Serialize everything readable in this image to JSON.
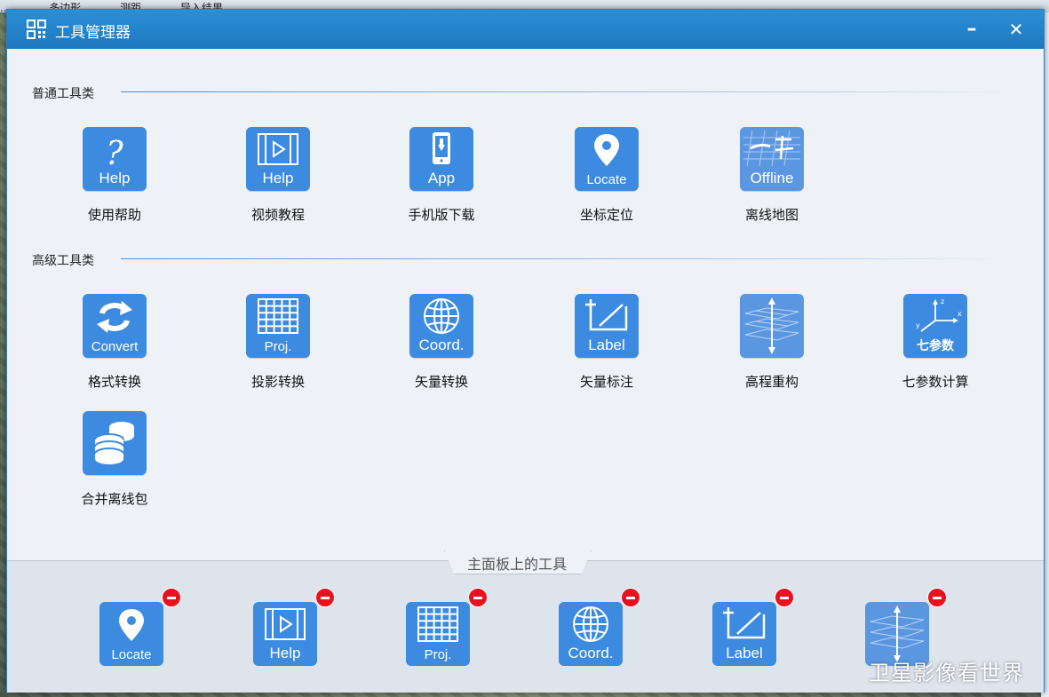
{
  "background": {
    "top_items": [
      "...",
      "多边形",
      "测距",
      "导入结果"
    ]
  },
  "window": {
    "title": "工具管理器",
    "minimize_label": "–",
    "close_label": "✕"
  },
  "sections": [
    {
      "label": "普通工具类",
      "tools": [
        {
          "label": "使用帮助",
          "icon": "help-question-icon",
          "icon_text": "Help"
        },
        {
          "label": "视频教程",
          "icon": "video-icon",
          "icon_text": "Help"
        },
        {
          "label": "手机版下载",
          "icon": "phone-download-icon",
          "icon_text": "App"
        },
        {
          "label": "坐标定位",
          "icon": "location-pin-icon",
          "icon_text": "Locate"
        },
        {
          "label": "离线地图",
          "icon": "offline-map-icon",
          "icon_text": "Offline"
        }
      ]
    },
    {
      "label": "高级工具类",
      "tools": [
        {
          "label": "格式转换",
          "icon": "convert-arrows-icon",
          "icon_text": "Convert"
        },
        {
          "label": "投影转换",
          "icon": "grid-projection-icon",
          "icon_text": "Proj."
        },
        {
          "label": "矢量转换",
          "icon": "globe-icon",
          "icon_text": "Coord."
        },
        {
          "label": "矢量标注",
          "icon": "label-pen-icon",
          "icon_text": "Label"
        },
        {
          "label": "高程重构",
          "icon": "elevation-layers-icon",
          "icon_text": ""
        },
        {
          "label": "七参数计算",
          "icon": "xyz-axes-icon",
          "icon_text": "七参数"
        },
        {
          "label": "合并离线包",
          "icon": "database-stack-icon",
          "icon_text": ""
        }
      ]
    }
  ],
  "panel": {
    "title": "主面板上的工具",
    "tools": [
      {
        "icon": "location-pin-icon",
        "icon_text": "Locate"
      },
      {
        "icon": "video-icon",
        "icon_text": "Help"
      },
      {
        "icon": "grid-projection-icon",
        "icon_text": "Proj."
      },
      {
        "icon": "globe-icon",
        "icon_text": "Coord."
      },
      {
        "icon": "label-pen-icon",
        "icon_text": "Label"
      },
      {
        "icon": "elevation-layers-icon",
        "icon_text": ""
      }
    ]
  },
  "watermark": "卫星影像看世界",
  "colors": {
    "titlebar": "#1e78bf",
    "icon_bg": "#3c8be0",
    "remove_badge": "#e8111d",
    "dialog_bg": "#eef2f7"
  }
}
